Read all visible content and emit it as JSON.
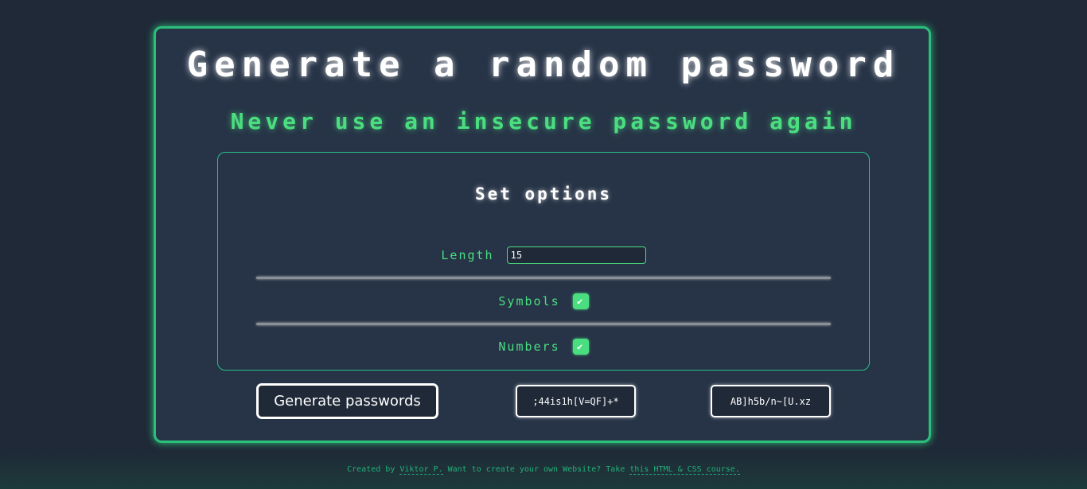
{
  "title": "Generate a random password",
  "subtitle": "Never use an insecure password again",
  "options": {
    "heading": "Set options",
    "length_label": "Length",
    "length_value": "15",
    "symbols_label": "Symbols",
    "symbols_checked": true,
    "numbers_label": "Numbers",
    "numbers_checked": true
  },
  "generate_label": "Generate passwords",
  "passwords": [
    ";44is1h[V=QF]+*",
    "AB]h5b/n~[U.xz"
  ],
  "footer": {
    "prefix": "Created by ",
    "author": "Viktor P.",
    "middle": " Want to create your own Website? Take ",
    "course": "this HTML & CSS course."
  }
}
